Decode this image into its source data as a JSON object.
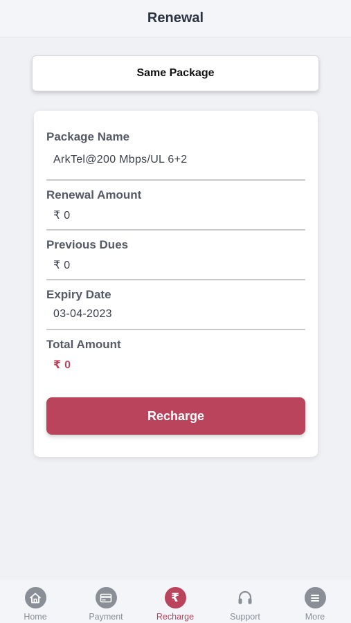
{
  "header": {
    "title": "Renewal"
  },
  "package_button": {
    "label": "Same Package"
  },
  "details": {
    "package_name": {
      "label": "Package Name",
      "value": "ArkTel@200 Mbps/UL 6+2"
    },
    "renewal_amount": {
      "label": "Renewal Amount",
      "value": "₹ 0"
    },
    "previous_dues": {
      "label": "Previous Dues",
      "value": "₹ 0"
    },
    "expiry_date": {
      "label": "Expiry Date",
      "value": "03-04-2023"
    },
    "total_amount": {
      "label": "Total Amount",
      "value": "₹ 0"
    }
  },
  "recharge_button": {
    "label": "Recharge"
  },
  "bottom_nav": {
    "items": [
      {
        "label": "Home",
        "icon": "home-icon"
      },
      {
        "label": "Payment",
        "icon": "card-icon"
      },
      {
        "label": "Recharge",
        "icon": "rupee-icon",
        "active": true
      },
      {
        "label": "Support",
        "icon": "headset-icon"
      },
      {
        "label": "More",
        "icon": "menu-icon"
      }
    ]
  },
  "colors": {
    "accent": "#b9445c",
    "background": "#f0f1f5",
    "nav_inactive": "#8a8e96"
  }
}
